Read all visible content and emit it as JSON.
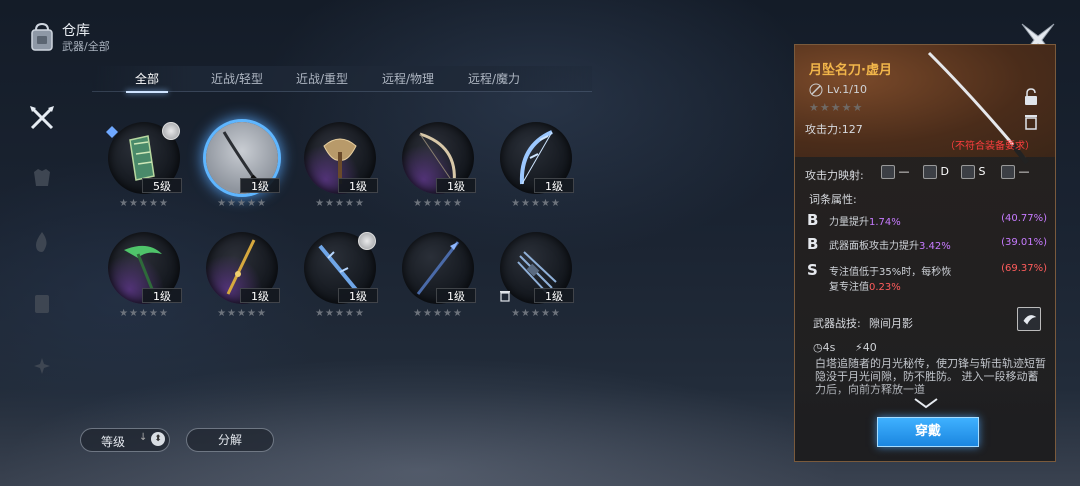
{
  "header": {
    "title": "仓库",
    "subtitle": "武器/全部"
  },
  "tabs": [
    {
      "label": "全部",
      "active": true
    },
    {
      "label": "近战/轻型"
    },
    {
      "label": "近战/重型"
    },
    {
      "label": "远程/物理"
    },
    {
      "label": "远程/魔力"
    }
  ],
  "left_nav": [
    "weapon-icon",
    "armor-icon",
    "fire-icon",
    "scroll-icon",
    "misc-icon"
  ],
  "items": [
    {
      "level": "5级",
      "weapon": "green-banner",
      "purple": false,
      "avatar": true,
      "gem": true,
      "selected": false
    },
    {
      "level": "1级",
      "weapon": "katana",
      "selected": true
    },
    {
      "level": "1级",
      "weapon": "axe",
      "purple": true
    },
    {
      "level": "1级",
      "weapon": "bow-plain",
      "purple": true
    },
    {
      "level": "1级",
      "weapon": "bow-ice"
    },
    {
      "level": "1级",
      "weapon": "scythe",
      "purple": true
    },
    {
      "level": "1级",
      "weapon": "golden-staff",
      "purple": true
    },
    {
      "level": "1级",
      "weapon": "sword-blue",
      "avatar": true
    },
    {
      "level": "1级",
      "weapon": "spear-blue"
    },
    {
      "level": "1级",
      "weapon": "claw",
      "trash": true
    }
  ],
  "stars": "★★★★★",
  "buttons": {
    "sort_label": "等级",
    "sort_arrows": "↓",
    "decompose_label": "分解"
  },
  "detail": {
    "name": "月坠名刀·虚月",
    "level": "Lv.1/10",
    "stars": "★★★★★",
    "attack": "攻击力:127",
    "warning": "（不符合装备要求）",
    "mapping_label": "攻击力映射:",
    "mapping": [
      {
        "icon": "strength-icon",
        "grade": "—"
      },
      {
        "icon": "agility-icon",
        "grade": "D"
      },
      {
        "icon": "intellect-icon",
        "grade": "S"
      },
      {
        "icon": "focus-icon",
        "grade": "—"
      }
    ],
    "affix_header": "词条属性:",
    "affixes": [
      {
        "grade": "B",
        "text": "力量提升",
        "value": "1.74%",
        "range": "(40.77%)",
        "color": "#c77bff"
      },
      {
        "grade": "B",
        "text": "武器面板攻击力提升",
        "value": "3.42%",
        "range": "(39.01%)",
        "color": "#c77bff"
      },
      {
        "grade": "S",
        "text": "专注值低于35%时，每秒恢",
        "text2": "复专注值",
        "value": "0.23%",
        "range": "(69.37%)",
        "color": "#ff5c5c"
      }
    ],
    "skill_label": "武器战技:",
    "skill_name": "隙间月影",
    "cooldown": "4s",
    "cost": "40",
    "description": "白塔追随者的月光秘传，使刀锋与斩击轨迹短暂隐没于月光间隙，防不胜防。\n进入一段移动蓄力后，向前方释放一道",
    "equip_label": "穿戴"
  },
  "colors": {
    "accent": "#3fb1ff",
    "legend_gold": "#f2b64a",
    "warning": "#ff3e3e",
    "purple": "#c77bff"
  }
}
